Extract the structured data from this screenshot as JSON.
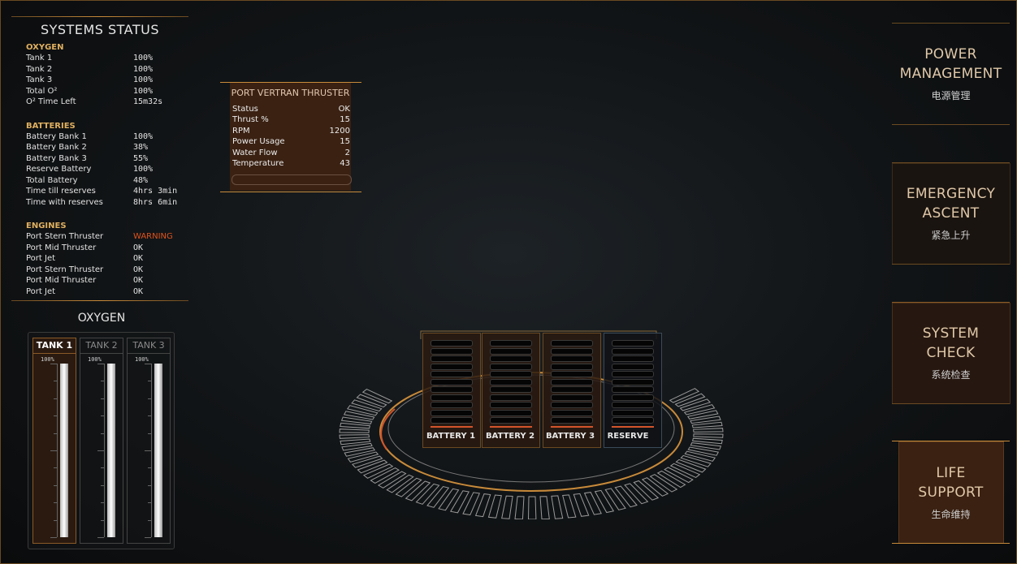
{
  "systems_status": {
    "title": "SYSTEMS STATUS",
    "oxygen": {
      "heading": "OXYGEN",
      "rows": [
        {
          "label": "Tank 1",
          "value": "100%"
        },
        {
          "label": "Tank 2",
          "value": "100%"
        },
        {
          "label": "Tank 3",
          "value": "100%"
        },
        {
          "label": "Total O²",
          "value": "100%"
        },
        {
          "label": "O² Time Left",
          "value": "15m32s"
        }
      ]
    },
    "batteries": {
      "heading": "BATTERIES",
      "rows": [
        {
          "label": "Battery Bank 1",
          "value": "100%"
        },
        {
          "label": "Battery Bank 2",
          "value": "38%"
        },
        {
          "label": "Battery Bank 3",
          "value": "55%"
        },
        {
          "label": "Reserve Battery",
          "value": "100%"
        },
        {
          "label": "Total Battery",
          "value": "48%"
        },
        {
          "label": "Time till reserves",
          "value": "4hrs 3min"
        },
        {
          "label": "Time with reserves",
          "value": "8hrs 6min"
        }
      ]
    },
    "engines": {
      "heading": "ENGINES",
      "rows": [
        {
          "label": "Port Stern Thruster",
          "value": "WARNING",
          "warn": true
        },
        {
          "label": "Port Mid Thruster",
          "value": "OK"
        },
        {
          "label": "Port Jet",
          "value": "OK"
        },
        {
          "label": "Port Stern Thruster",
          "value": "OK"
        },
        {
          "label": "Port Mid Thruster",
          "value": "OK"
        },
        {
          "label": "Port Jet",
          "value": "OK"
        }
      ]
    }
  },
  "oxygen_panel": {
    "title": "OXYGEN",
    "tanks": [
      {
        "label": "TANK 1",
        "percent_label": "100%",
        "level": 1.0,
        "active": true
      },
      {
        "label": "TANK 2",
        "percent_label": "100%",
        "level": 1.0,
        "active": false
      },
      {
        "label": "TANK 3",
        "percent_label": "100%",
        "level": 1.0,
        "active": false
      }
    ]
  },
  "thruster_panel": {
    "title": "PORT VERTRAN THRUSTER",
    "rows": [
      {
        "label": "Status",
        "value": "OK"
      },
      {
        "label": "Thrust %",
        "value": "15"
      },
      {
        "label": "RPM",
        "value": "1200"
      },
      {
        "label": "Power Usage",
        "value": "15"
      },
      {
        "label": "Water Flow",
        "value": "2"
      },
      {
        "label": "Temperature",
        "value": "43"
      }
    ]
  },
  "battery_display": {
    "banks": [
      {
        "label": "BATTERY 1",
        "reserve": false
      },
      {
        "label": "BATTERY 2",
        "reserve": false
      },
      {
        "label": "BATTERY 3",
        "reserve": false
      },
      {
        "label": "RESERVE",
        "reserve": true
      }
    ]
  },
  "nav": [
    {
      "id": "power-management",
      "en": [
        "POWER",
        "MANAGEMENT"
      ],
      "cn": "电源管理",
      "active": false
    },
    {
      "id": "emergency-ascent",
      "en": [
        "EMERGENCY",
        "ASCENT"
      ],
      "cn": "紧急上升",
      "active": false
    },
    {
      "id": "system-check",
      "en": [
        "SYSTEM",
        "CHECK"
      ],
      "cn": "系统检查",
      "active": false
    },
    {
      "id": "life-support",
      "en": [
        "LIFE",
        "SUPPORT"
      ],
      "cn": "生命维持",
      "active": true
    }
  ],
  "colors": {
    "accent": "#c88a3a",
    "panel": "#3a2112",
    "warning": "#e0531d",
    "battery_fill": "#d2542a"
  }
}
